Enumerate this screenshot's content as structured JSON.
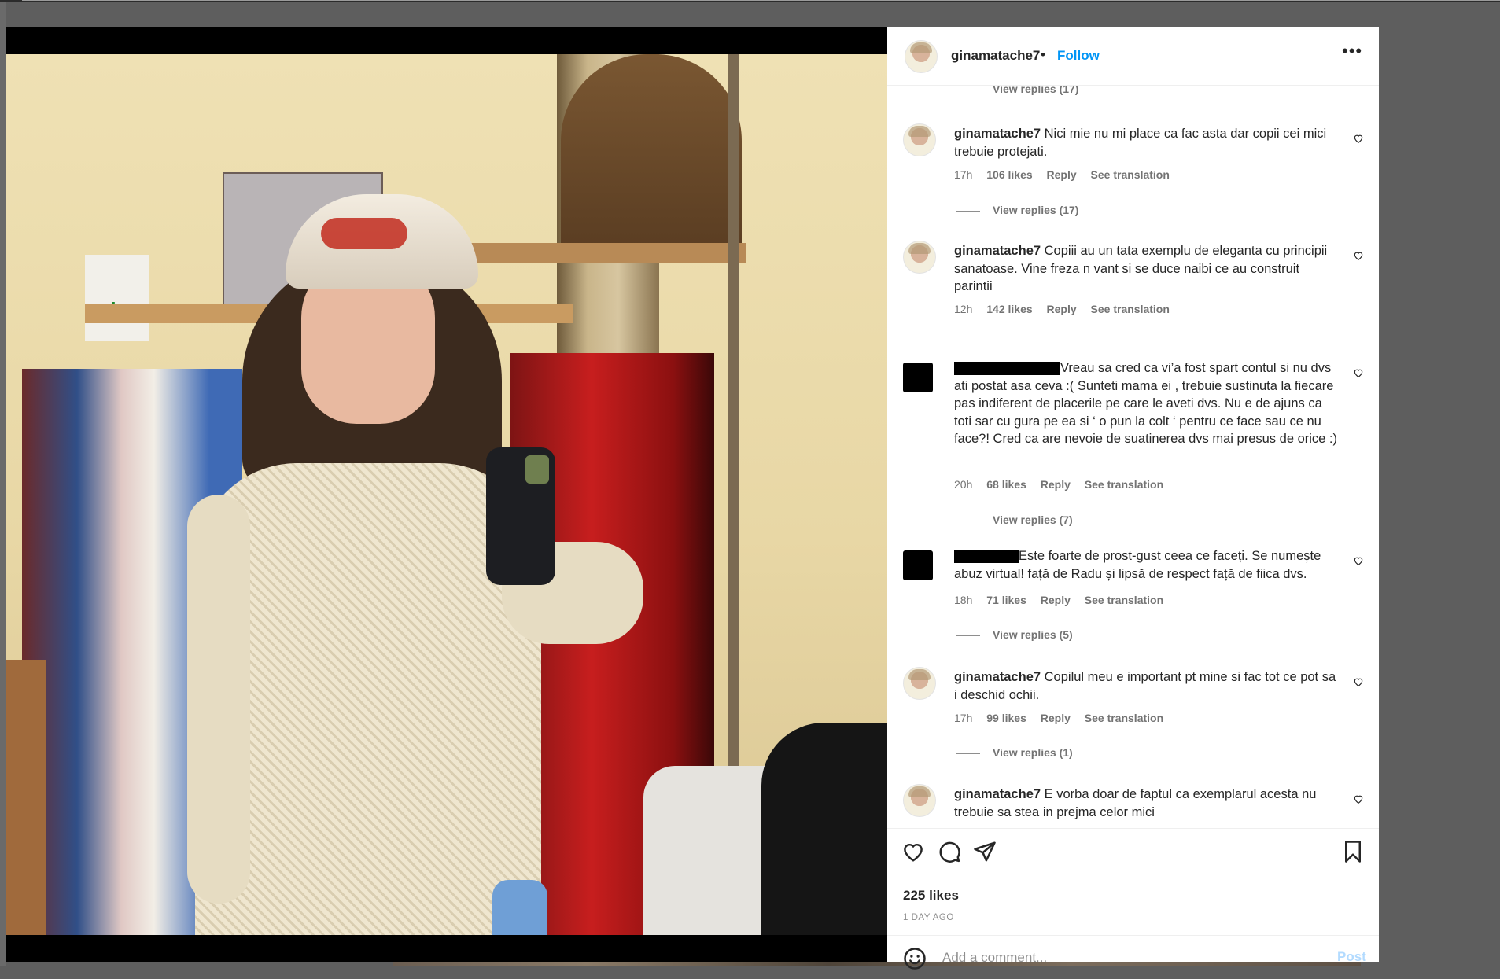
{
  "post": {
    "username": "ginamatache7",
    "separator": "•",
    "follow_label": "Follow",
    "more_icon": "more-horizontal-icon",
    "likes": "225 likes",
    "time_ago": "1 DAY AGO"
  },
  "top_view_replies": "View replies (17)",
  "comments": [
    {
      "username": "ginamatache7",
      "text": "Nici mie nu mi place ca fac asta dar copii cei mici trebuie protejati.",
      "time": "17h",
      "likes": "106 likes",
      "reply": "Reply",
      "translate": "See translation",
      "view_replies": "View replies (17)"
    },
    {
      "username": "ginamatache7",
      "text": "Copiii au un tata exemplu de eleganta cu principii sanatoase. Vine freza n vant si se duce naibi ce au construit parintii",
      "time": "12h",
      "likes": "142 likes",
      "reply": "Reply",
      "translate": "See translation",
      "view_replies": ""
    },
    {
      "username": "",
      "text": "Vreau sa cred ca vi’a fost spart contul si nu dvs ati postat asa ceva :( Sunteti mama ei , trebuie sustinuta la fiecare pas indiferent de placerile pe care le aveti dvs. Nu e de ajuns ca toti sar cu gura pe ea si ‘ o pun la colt ‘ pentru ce face sau ce nu face?! Cred ca are nevoie de suatinerea dvs mai presus de orice :)",
      "time": "20h",
      "likes": "68 likes",
      "reply": "Reply",
      "translate": "See translation",
      "view_replies": "View replies (7)"
    },
    {
      "username": "",
      "text": "Este foarte de prost-gust ceea ce faceți. Se numește abuz virtual! față de Radu și lipsă de respect față de fiica dvs.",
      "time": "18h",
      "likes": "71 likes",
      "reply": "Reply",
      "translate": "See translation",
      "view_replies": "View replies (5)"
    },
    {
      "username": "ginamatache7",
      "text": "Copilul meu e important pt mine si fac tot ce pot sa i deschid ochii.",
      "time": "17h",
      "likes": "99 likes",
      "reply": "Reply",
      "translate": "See translation",
      "view_replies": "View replies (1)"
    },
    {
      "username": "ginamatache7",
      "text": "E vorba doar de faptul ca exemplarul acesta nu trebuie sa stea in prejma celor mici",
      "time": "",
      "likes": "",
      "reply": "",
      "translate": "",
      "view_replies": ""
    }
  ],
  "action_icons": [
    "heart-icon",
    "comment-icon",
    "share-icon",
    "bookmark-icon"
  ],
  "comment_box": {
    "placeholder": "Add a comment...",
    "post_label": "Post",
    "emoji_icon": "emoji-icon"
  },
  "colors": {
    "link_blue": "#0095f6",
    "post_disabled": "#b3dbff",
    "text": "#262626",
    "secondary": "#737373"
  }
}
